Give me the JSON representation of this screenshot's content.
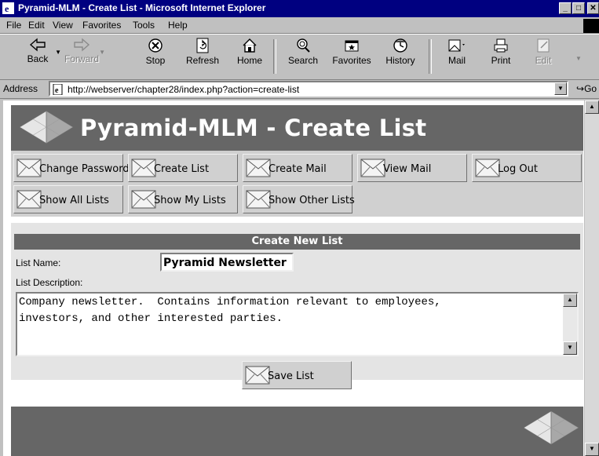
{
  "window": {
    "title": "Pyramid-MLM - Create List - Microsoft Internet Explorer"
  },
  "menu": [
    {
      "label": "File"
    },
    {
      "label": "Edit"
    },
    {
      "label": "View"
    },
    {
      "label": "Favorites"
    },
    {
      "label": "Tools"
    },
    {
      "label": "Help"
    }
  ],
  "toolbar": {
    "back": "Back",
    "forward": "Forward",
    "stop": "Stop",
    "refresh": "Refresh",
    "home": "Home",
    "search": "Search",
    "favorites": "Favorites",
    "history": "History",
    "mail": "Mail",
    "print": "Print",
    "edit": "Edit"
  },
  "address": {
    "label": "Address",
    "url": "http://webserver/chapter28/index.php?action=create-list",
    "go": "Go"
  },
  "page": {
    "title": "Pyramid-MLM - Create List",
    "nav": [
      {
        "label": "Change Password"
      },
      {
        "label": "Create List"
      },
      {
        "label": "Create Mail"
      },
      {
        "label": "View Mail"
      },
      {
        "label": "Log Out"
      },
      {
        "label": "Show All Lists"
      },
      {
        "label": "Show My Lists"
      },
      {
        "label": "Show Other Lists"
      }
    ],
    "form": {
      "heading": "Create New List",
      "name_label": "List Name:",
      "name_value": "Pyramid Newsletter",
      "desc_label": "List Description:",
      "desc_value": "Company newsletter.  Contains information relevant to employees,\ninvestors, and other interested parties.",
      "save_label": "Save List"
    }
  },
  "colors": {
    "titlebar": "#000080",
    "header": "#666666",
    "panel": "#d0d0d0"
  }
}
